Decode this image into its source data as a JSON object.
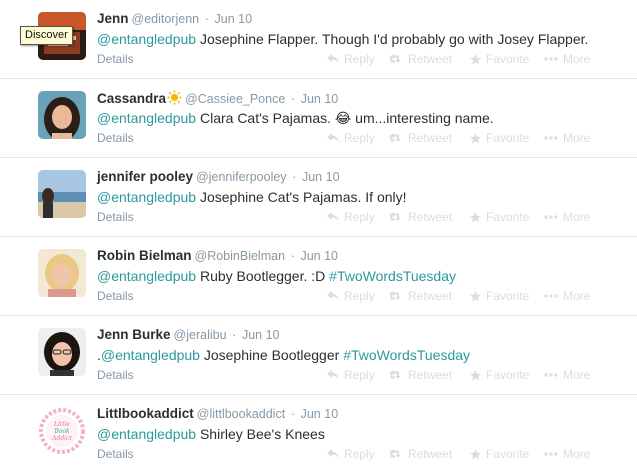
{
  "tweets": [
    {
      "name": "Jenn",
      "handle": "@editorjenn",
      "sep": "·",
      "time": "Jun 10",
      "mention": "@entangledpub",
      "text": " Josephine Flapper. Though I'd probably go with Josey Flapper.",
      "details": "Details"
    },
    {
      "name": "Cassandra",
      "handle": "@Cassiee_Ponce",
      "sep": "·",
      "time": "Jun 10",
      "mention": "@entangledpub",
      "text": " Clara Cat's Pajamas. 😂 um...interesting name.",
      "details": "Details"
    },
    {
      "name": "jennifer pooley",
      "handle": "@jenniferpooley",
      "sep": "·",
      "time": "Jun 10",
      "mention": "@entangledpub",
      "text": " Josephine Cat's Pajamas. If only!",
      "details": "Details"
    },
    {
      "name": "Robin Bielman",
      "handle": "@RobinBielman",
      "sep": "·",
      "time": "Jun 10",
      "mention": "@entangledpub",
      "text": " Ruby Bootlegger. :D ",
      "hashtag": "#TwoWordsTuesday",
      "details": "Details"
    },
    {
      "name": "Jenn Burke",
      "handle": "@jeralibu",
      "sep": "·",
      "time": "Jun 10",
      "prefix": ".",
      "mention": "@entangledpub",
      "text": " Josephine Bootlegger ",
      "hashtag": "#TwoWordsTuesday",
      "details": "Details"
    },
    {
      "name": "Littlbookaddict",
      "handle": "@littlbookaddict",
      "sep": "·",
      "time": "Jun 10",
      "mention": "@entangledpub",
      "text": " Shirley Bee's Knees",
      "details": "Details"
    }
  ],
  "actions": {
    "reply": "Reply",
    "retweet": "Retweet",
    "favorite": "Favorite",
    "more": "More"
  },
  "tooltip": "Discover",
  "avatar_logo_lines": [
    "Little",
    "Book",
    "Addict"
  ],
  "colors": {
    "link": "#2b9a9c",
    "muted": "#8899a6",
    "actions_faded": "#d8dde2",
    "divider": "#e1e8ed"
  }
}
